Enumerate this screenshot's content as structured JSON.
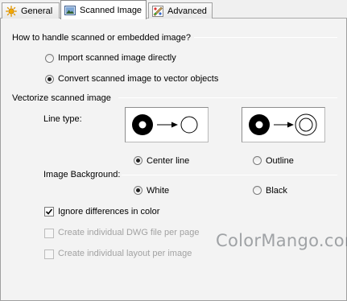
{
  "tabs": [
    {
      "label": "General",
      "icon": "sun-icon"
    },
    {
      "label": "Scanned Image",
      "icon": "picture-icon"
    },
    {
      "label": "Advanced",
      "icon": "palette-icon"
    }
  ],
  "handling": {
    "heading": "How to handle scanned or embedded image?",
    "options": [
      {
        "label": "Import scanned image directly",
        "selected": false
      },
      {
        "label": "Convert scanned image to vector objects",
        "selected": true
      }
    ]
  },
  "vectorize": {
    "heading": "Vectorize scanned image",
    "line_type_label": "Line type:",
    "line_type_options": [
      {
        "label": "Center line",
        "selected": true
      },
      {
        "label": "Outline",
        "selected": false
      }
    ],
    "background_label": "Image Background:",
    "background_options": [
      {
        "label": "White",
        "selected": true
      },
      {
        "label": "Black",
        "selected": false
      }
    ],
    "checkboxes": [
      {
        "label": "Ignore differences in color",
        "checked": true,
        "enabled": true
      },
      {
        "label": "Create individual DWG file per page",
        "checked": false,
        "enabled": false
      },
      {
        "label": "Create  individual layout per image",
        "checked": false,
        "enabled": false
      }
    ]
  },
  "watermark": "ColorMango.com",
  "colors": {
    "panel": "#f3f3f3",
    "disabled_text": "#a2a2a2",
    "separator": "#a8a8a8"
  }
}
